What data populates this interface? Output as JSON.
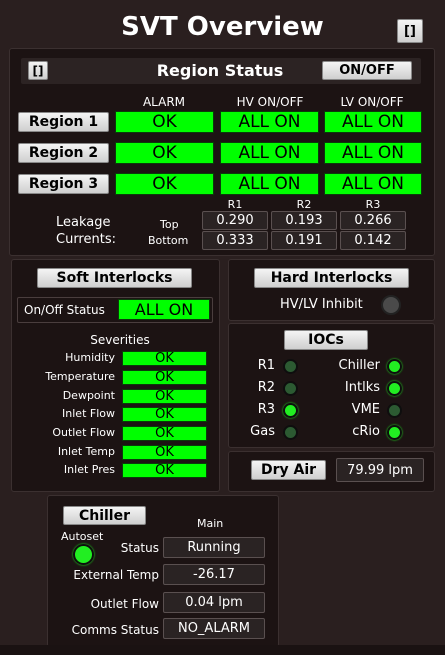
{
  "header": {
    "title": "SVT Overview",
    "corner_button": "[]"
  },
  "region_status": {
    "title": "Region Status",
    "expand_button": "[]",
    "onoff_button": "ON/OFF",
    "columns": {
      "alarm": "ALARM",
      "hv": "HV ON/OFF",
      "lv": "LV ON/OFF"
    },
    "regions": [
      {
        "label": "Region 1",
        "alarm": "OK",
        "hv": "ALL ON",
        "lv": "ALL ON"
      },
      {
        "label": "Region 2",
        "alarm": "OK",
        "hv": "ALL ON",
        "lv": "ALL ON"
      },
      {
        "label": "Region 3",
        "alarm": "OK",
        "hv": "ALL ON",
        "lv": "ALL ON"
      }
    ],
    "leakage": {
      "label_line1": "Leakage",
      "label_line2": "Currents:",
      "cols": [
        "R1",
        "R2",
        "R3"
      ],
      "top_label": "Top",
      "bottom_label": "Bottom",
      "top": [
        "0.290",
        "0.193",
        "0.266"
      ],
      "bottom": [
        "0.333",
        "0.191",
        "0.142"
      ]
    }
  },
  "soft_interlocks": {
    "button": "Soft Interlocks",
    "onoff_label": "On/Off Status",
    "onoff_value": "ALL ON",
    "severities_title": "Severities",
    "items": [
      {
        "label": "Humidity",
        "value": "OK"
      },
      {
        "label": "Temperature",
        "value": "OK"
      },
      {
        "label": "Dewpoint",
        "value": "OK"
      },
      {
        "label": "Inlet Flow",
        "value": "OK"
      },
      {
        "label": "Outlet Flow",
        "value": "OK"
      },
      {
        "label": "Inlet Temp",
        "value": "OK"
      },
      {
        "label": "Inlet Pres",
        "value": "OK"
      }
    ]
  },
  "hard_interlocks": {
    "button": "Hard Interlocks",
    "inhibit_label": "HV/LV Inhibit"
  },
  "iocs": {
    "button": "IOCs",
    "left": [
      {
        "label": "R1",
        "state": "off"
      },
      {
        "label": "R2",
        "state": "off"
      },
      {
        "label": "R3",
        "state": "on"
      },
      {
        "label": "Gas",
        "state": "off"
      }
    ],
    "right": [
      {
        "label": "Chiller",
        "state": "on"
      },
      {
        "label": "Intlks",
        "state": "on"
      },
      {
        "label": "VME",
        "state": "off"
      },
      {
        "label": "cRio",
        "state": "on"
      }
    ]
  },
  "dry_air": {
    "button": "Dry Air",
    "value": "79.99 lpm"
  },
  "chiller": {
    "button": "Chiller",
    "main_label": "Main",
    "autoset_label": "Autoset",
    "status_label": "Status",
    "status_value": "Running",
    "ext_temp_label": "External Temp",
    "ext_temp_value": "-26.17",
    "outlet_flow_label": "Outlet Flow",
    "outlet_flow_value": "0.04 lpm",
    "comms_label": "Comms Status",
    "comms_value": "NO_ALARM"
  },
  "colors": {
    "ok_green": "#00ff00",
    "led_on": "#22ee22",
    "led_off": "#2c5a32",
    "background": "#2a1f1f"
  }
}
